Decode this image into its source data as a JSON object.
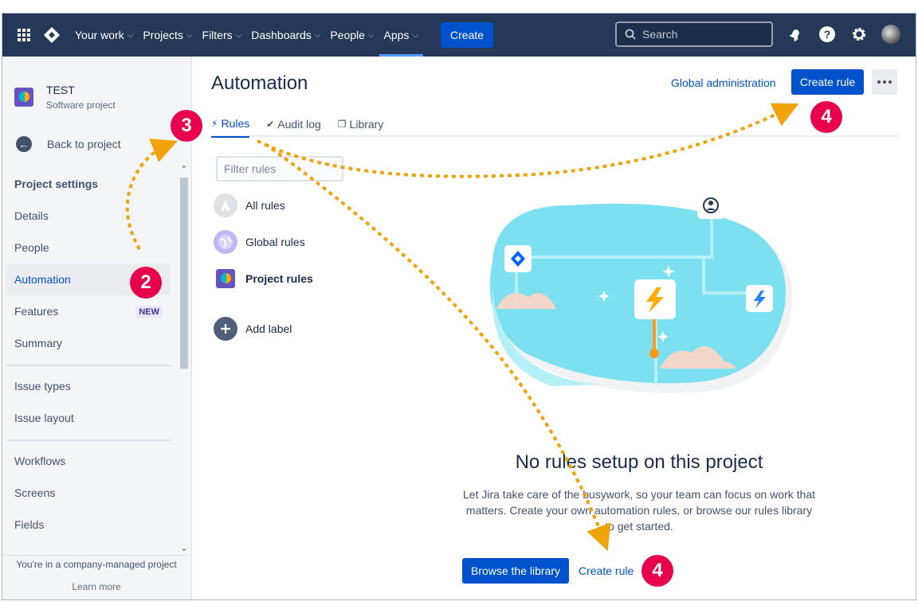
{
  "nav": {
    "items": [
      {
        "label": "Your work"
      },
      {
        "label": "Projects"
      },
      {
        "label": "Filters"
      },
      {
        "label": "Dashboards"
      },
      {
        "label": "People"
      },
      {
        "label": "Apps"
      }
    ],
    "create_label": "Create",
    "search_placeholder": "Search"
  },
  "sidebar": {
    "project_name": "TEST",
    "project_type": "Software project",
    "back_label": "Back to project",
    "settings_heading": "Project settings",
    "items": [
      {
        "label": "Details"
      },
      {
        "label": "People"
      },
      {
        "label": "Automation"
      },
      {
        "label": "Features",
        "badge": "NEW"
      },
      {
        "label": "Summary"
      },
      {
        "label": "Issue types"
      },
      {
        "label": "Issue layout"
      },
      {
        "label": "Workflows"
      },
      {
        "label": "Screens"
      },
      {
        "label": "Fields"
      }
    ],
    "footer_text": "You're in a company-managed project",
    "learn_more": "Learn more"
  },
  "main": {
    "title": "Automation",
    "global_admin": "Global administration",
    "create_rule": "Create rule",
    "tabs": [
      {
        "label": "Rules"
      },
      {
        "label": "Audit log"
      },
      {
        "label": "Library"
      }
    ],
    "filter_placeholder": "Filter rules",
    "rule_categories": [
      {
        "label": "All rules"
      },
      {
        "label": "Global rules"
      },
      {
        "label": "Project rules"
      },
      {
        "label": "Add label"
      }
    ],
    "empty_title": "No rules setup on this project",
    "empty_description": "Let Jira take care of the busywork, so your team can focus on work that matters. Create your own automation rules, or browse our rules library to get started.",
    "browse_library": "Browse the library",
    "create_rule_link": "Create rule"
  },
  "annotations": {
    "step2": "2",
    "step3": "3",
    "step4a": "4",
    "step4b": "4",
    "marker_color": "#e8004c",
    "arrow_color": "#f0a30a"
  },
  "colors": {
    "nav_bg": "#253858",
    "primary": "#0052cc",
    "sidebar_bg": "#f4f5f7"
  }
}
